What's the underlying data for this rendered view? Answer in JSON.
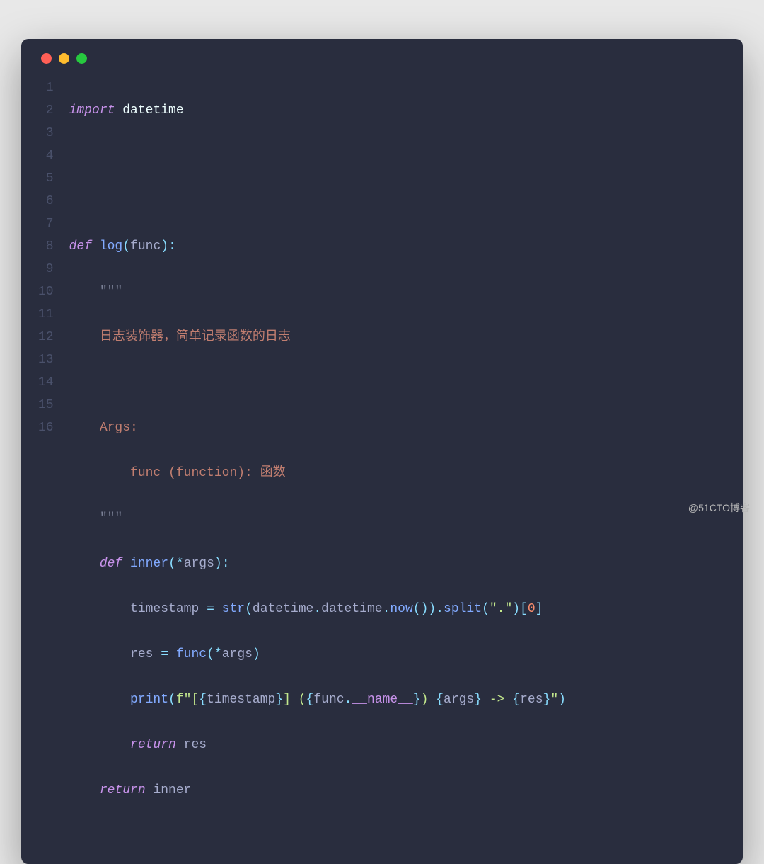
{
  "watermark": "@51CTO博客",
  "lineNumbers": [
    "1",
    "2",
    "3",
    "4",
    "5",
    "6",
    "7",
    "8",
    "9",
    "10",
    "11",
    "12",
    "13",
    "14",
    "15",
    "16"
  ],
  "code": {
    "l1": {
      "import": "import",
      "module": "datetime"
    },
    "l4": {
      "def": "def",
      "name": "log",
      "lp": "(",
      "param": "func",
      "rp": ")",
      "colon": ":"
    },
    "l5": {
      "quote": "\"\"\""
    },
    "l6": {
      "text": "日志装饰器，简单记录函数的日志"
    },
    "l8": {
      "text": "Args:"
    },
    "l9": {
      "text": "func (function): 函数"
    },
    "l10": {
      "quote": "\"\"\""
    },
    "l11": {
      "def": "def",
      "name": "inner",
      "lp": "(",
      "star": "*",
      "param": "args",
      "rp": ")",
      "colon": ":"
    },
    "l12": {
      "lhs": "timestamp",
      "eq": "=",
      "str": "str",
      "lp1": "(",
      "dt1": "datetime",
      "dot1": ".",
      "dt2": "datetime",
      "dot2": ".",
      "now": "now",
      "lp2": "(",
      "rp2": ")",
      "rp1": ")",
      "dot3": ".",
      "split": "split",
      "lp3": "(",
      "arg": "\".\"",
      "rp3": ")",
      "lb": "[",
      "idx": "0",
      "rb": "]"
    },
    "l13": {
      "lhs": "res",
      "eq": "=",
      "func": "func",
      "lp": "(",
      "star": "*",
      "args": "args",
      "rp": ")"
    },
    "l14": {
      "print": "print",
      "lp": "(",
      "f": "f\"",
      "t1": "[",
      "lb1": "{",
      "v1": "timestamp",
      "rb1": "}",
      "t2": "] (",
      "lb2": "{",
      "v2a": "func",
      "dot": ".",
      "v2b": "__name__",
      "rb2": "}",
      "t3": ") ",
      "lb3": "{",
      "v3": "args",
      "rb3": "}",
      "t4": " -> ",
      "lb4": "{",
      "v4": "res",
      "rb4": "}",
      "endq": "\"",
      "rp": ")"
    },
    "l15": {
      "return": "return",
      "val": "res"
    },
    "l16": {
      "return": "return",
      "val": "inner"
    }
  }
}
